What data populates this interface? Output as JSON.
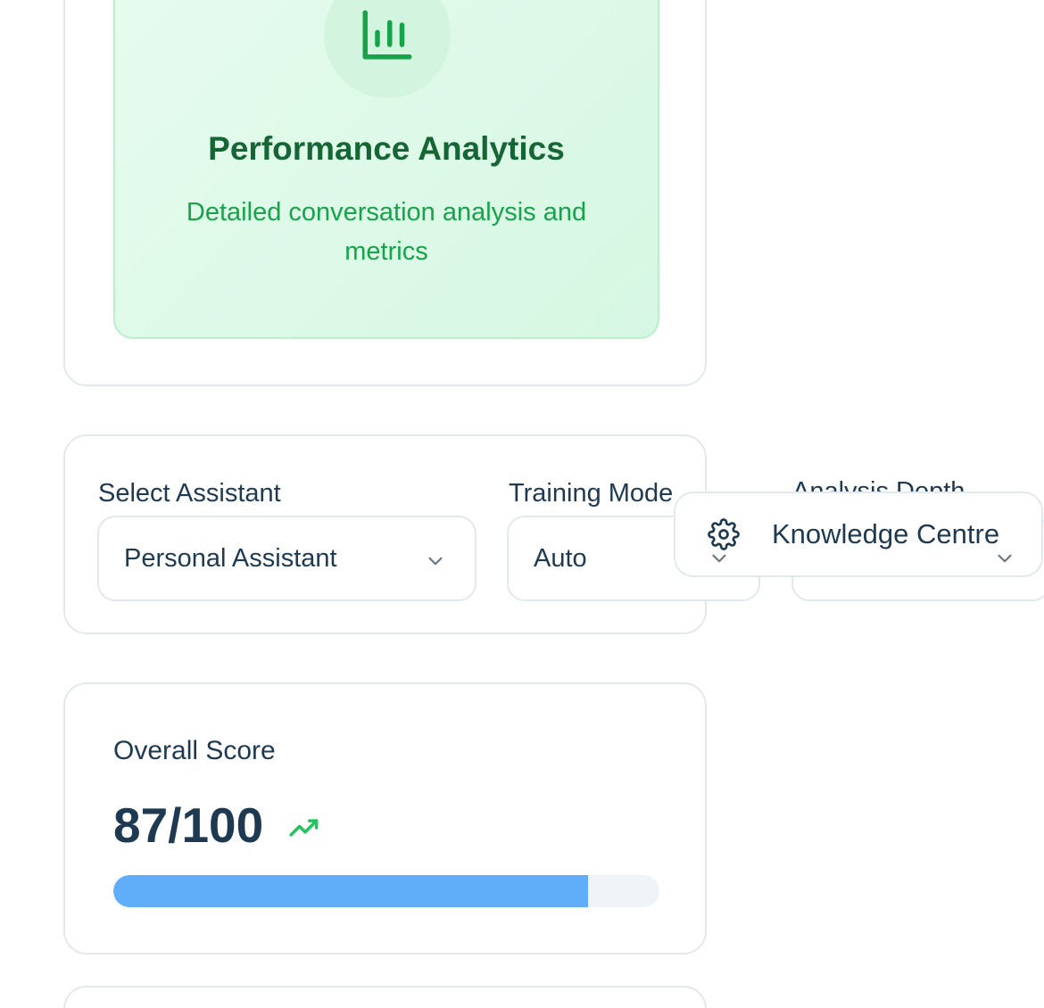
{
  "feature": {
    "icon": "bar-chart-icon",
    "title": "Performance Analytics",
    "description": "Detailed conversation analysis and metrics",
    "accent_color": "#166534",
    "text_color": "#16a34a"
  },
  "settings": {
    "assistant": {
      "label": "Select Assistant",
      "value": "Personal Assistant"
    },
    "training_mode": {
      "label": "Training Mode",
      "value": "Auto"
    },
    "analysis_depth": {
      "label": "Analysis Depth",
      "value": ""
    }
  },
  "popup": {
    "icon": "gear-icon",
    "label": "Knowledge Centre"
  },
  "score": {
    "label": "Overall Score",
    "value": "87/100",
    "progress_fraction": 0.87,
    "trend": "up",
    "trend_color": "#22c55e",
    "bar_color": "#60aefa"
  }
}
